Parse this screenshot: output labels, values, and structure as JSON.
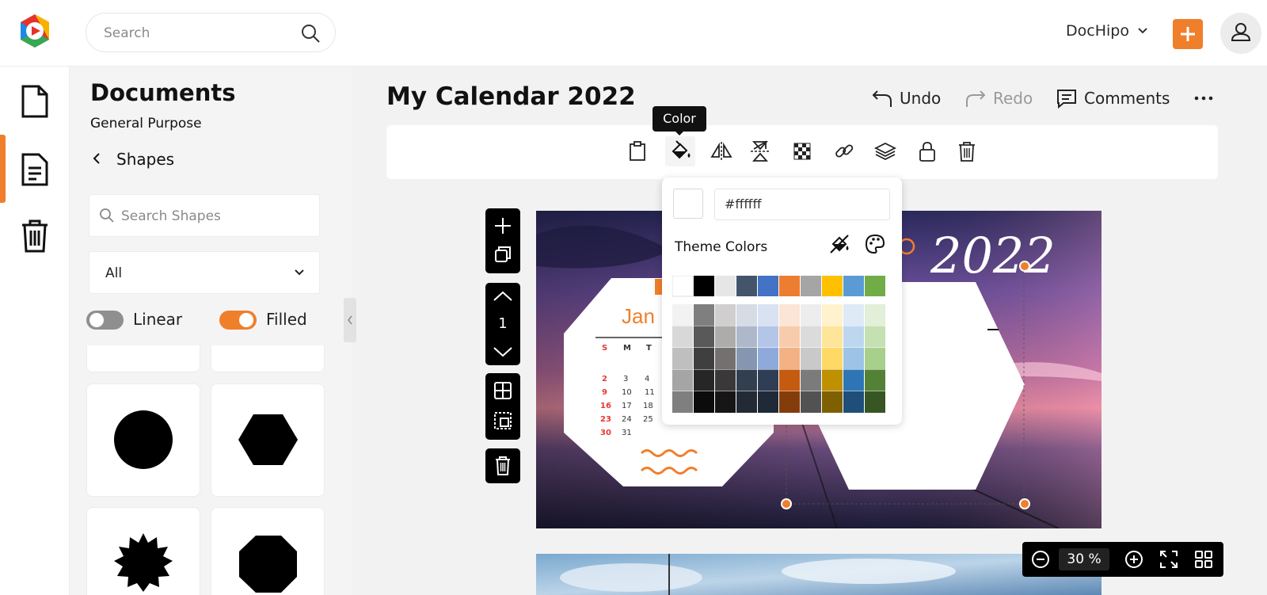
{
  "header": {
    "search_placeholder": "Search",
    "brand_name": "DocHipo",
    "accent_color": "#f07f2b"
  },
  "rail": {
    "items": [
      "new-document-icon",
      "documents-icon",
      "trash-icon"
    ],
    "active_index": 1
  },
  "panel": {
    "title": "Documents",
    "subtitle": "General Purpose",
    "back_label": "Shapes",
    "search_placeholder": "Search Shapes",
    "filter_value": "All",
    "toggle_linear": {
      "label": "Linear",
      "on": false
    },
    "toggle_filled": {
      "label": "Filled",
      "on": true
    },
    "shapes": [
      "circle",
      "hexagon",
      "starburst",
      "octagon"
    ]
  },
  "editor": {
    "doc_title": "My Calendar 2022",
    "undo_label": "Undo",
    "redo_label": "Redo",
    "comments_label": "Comments",
    "tooltip": "Color",
    "page_number": "1"
  },
  "canvas": {
    "year": "2022",
    "month": "Jan",
    "weekdays": [
      "S",
      "M",
      "T"
    ],
    "rows": [
      [
        "2",
        "3",
        "4"
      ],
      [
        "9",
        "10",
        "11"
      ],
      [
        "16",
        "17",
        "18"
      ],
      [
        "23",
        "24",
        "25"
      ],
      [
        "30",
        "31",
        ""
      ]
    ]
  },
  "color_picker": {
    "hex_value": "#ffffff",
    "theme_colors_label": "Theme Colors",
    "theme_row": [
      "#ffffff",
      "#000000",
      "#e7e6e6",
      "#44546a",
      "#4472c4",
      "#ed7d31",
      "#a5a5a5",
      "#ffc000",
      "#5b9bd5",
      "#70ad47"
    ],
    "shades": [
      [
        "#f2f2f2",
        "#7f7f7f",
        "#d0cece",
        "#d6dce4",
        "#d9e2f3",
        "#fbe5d5",
        "#ededed",
        "#fff2cc",
        "#deeaf6",
        "#e2efd9"
      ],
      [
        "#d8d8d8",
        "#595959",
        "#aeabab",
        "#adb9ca",
        "#b4c6e7",
        "#f7cbac",
        "#dbdbdb",
        "#fee599",
        "#bdd7ee",
        "#c5e0b3"
      ],
      [
        "#bfbfbf",
        "#3f3f3f",
        "#757070",
        "#8496b0",
        "#8eaadb",
        "#f4b183",
        "#c9c9c9",
        "#ffd965",
        "#9dc3e6",
        "#a8d08d"
      ],
      [
        "#a5a5a5",
        "#262626",
        "#3a3838",
        "#323f4f",
        "#2f3e55",
        "#c55a11",
        "#7b7b7b",
        "#bf9000",
        "#2e75b5",
        "#538135"
      ],
      [
        "#7f7f7f",
        "#0c0c0c",
        "#171616",
        "#222a35",
        "#1f2937",
        "#843c0b",
        "#525252",
        "#7f6000",
        "#1e4e79",
        "#375623"
      ]
    ]
  },
  "zoom": {
    "value": "30",
    "unit": "%"
  }
}
